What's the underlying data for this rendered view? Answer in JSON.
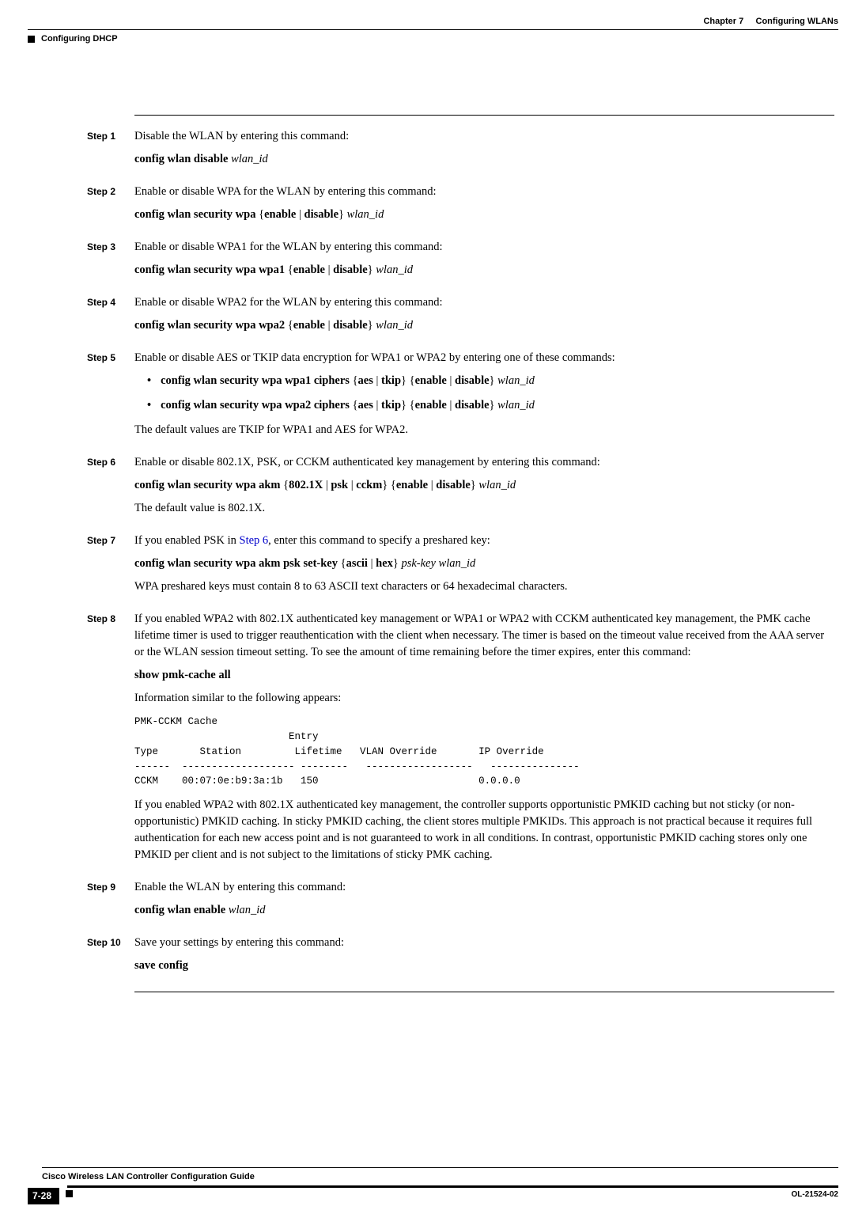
{
  "header": {
    "chapter_label": "Chapter 7",
    "chapter_title": "Configuring WLANs",
    "section_title": "Configuring DHCP"
  },
  "steps": [
    {
      "label": "Step 1",
      "lines": [
        {
          "type": "text",
          "value": "Disable the WLAN by entering this command:"
        },
        {
          "type": "cmd",
          "prefix": "config wlan disable ",
          "suffix_italic": "wlan_id"
        }
      ]
    },
    {
      "label": "Step 2",
      "lines": [
        {
          "type": "text",
          "value": "Enable or disable WPA for the WLAN by entering this command:"
        },
        {
          "type": "cmd",
          "prefix": "config wlan security wpa ",
          "mid1": "{",
          "mid2": "enable",
          "mid3": " | ",
          "mid4": "disable",
          "mid5": "} ",
          "suffix_italic": "wlan_id"
        }
      ]
    },
    {
      "label": "Step 3",
      "lines": [
        {
          "type": "text",
          "value": "Enable or disable WPA1 for the WLAN by entering this command:"
        },
        {
          "type": "cmd",
          "prefix": "config wlan security wpa wpa1 ",
          "mid1": "{",
          "mid2": "enable",
          "mid3": " | ",
          "mid4": "disable",
          "mid5": "} ",
          "suffix_italic": "wlan_id"
        }
      ]
    },
    {
      "label": "Step 4",
      "lines": [
        {
          "type": "text",
          "value": "Enable or disable WPA2 for the WLAN by entering this command:"
        },
        {
          "type": "cmd",
          "prefix": "config wlan security wpa wpa2 ",
          "mid1": "{",
          "mid2": "enable",
          "mid3": " | ",
          "mid4": "disable",
          "mid5": "} ",
          "suffix_italic": "wlan_id"
        }
      ]
    },
    {
      "label": "Step 5",
      "intro": "Enable or disable AES or TKIP data encryption for WPA1 or WPA2 by entering one of these commands:",
      "bullets": [
        {
          "prefix": "config wlan security wpa wpa1 ciphers ",
          "braces1": "{",
          "opt1": "aes",
          "sep1": " | ",
          "opt2": "tkip",
          "braces2": "} {",
          "opt3": "enable",
          "sep2": " | ",
          "opt4": "disable",
          "braces3": "} ",
          "suffix_italic": "wlan_id"
        },
        {
          "prefix": "config wlan security wpa wpa2 ciphers ",
          "braces1": "{",
          "opt1": "aes",
          "sep1": " | ",
          "opt2": "tkip",
          "braces2": "} {",
          "opt3": "enable",
          "sep2": " | ",
          "opt4": "disable",
          "braces3": "} ",
          "suffix_italic": "wlan_id"
        }
      ],
      "outro": "The default values are TKIP for WPA1 and AES for WPA2."
    },
    {
      "label": "Step 6",
      "lines": [
        {
          "type": "text",
          "value": "Enable or disable 802.1X, PSK, or CCKM authenticated key management by entering this command:"
        },
        {
          "type": "cmd_akm",
          "prefix": "config wlan security wpa akm ",
          "b1": "{",
          "o1": "802.1X",
          "s1": " | ",
          "o2": "psk",
          "s2": " | ",
          "o3": "cckm",
          "b2": "} {",
          "o4": "enable",
          "s3": " | ",
          "o5": "disable",
          "b3": "} ",
          "suffix_italic": "wlan_id"
        },
        {
          "type": "text",
          "value": "The default value is 802.1X."
        }
      ]
    },
    {
      "label": "Step 7",
      "step7_intro_pre": "If you enabled PSK in ",
      "step7_link": "Step 6",
      "step7_intro_post": ", enter this command to specify a preshared key:",
      "cmd_prefix": "config wlan security wpa akm psk set-key ",
      "cmd_b1": "{",
      "cmd_o1": "ascii",
      "cmd_s1": " | ",
      "cmd_o2": "hex",
      "cmd_b2": "} ",
      "cmd_suffix_italic": "psk-key wlan_id",
      "note": "WPA preshared keys must contain 8 to 63 ASCII text characters or 64 hexadecimal characters."
    },
    {
      "label": "Step 8",
      "intro": "If you enabled WPA2 with 802.1X authenticated key management or WPA1 or WPA2 with CCKM authenticated key management, the PMK cache lifetime timer is used to trigger reauthentication with the client when necessary. The timer is based on the timeout value received from the AAA server or the WLAN session timeout setting. To see the amount of time remaining before the timer expires, enter this command:",
      "cmd": "show pmk-cache all",
      "after_cmd": "Information similar to the following appears:",
      "code_output": "PMK-CCKM Cache\n                          Entry\nType       Station         Lifetime   VLAN Override       IP Override\n------  ------------------- --------   ------------------   ---------------\nCCKM    00:07:0e:b9:3a:1b   150                           0.0.0.0",
      "outro": "If you enabled WPA2 with 802.1X authenticated key management, the controller supports opportunistic PMKID caching but not sticky (or non-opportunistic) PMKID caching. In sticky PMKID caching, the client stores multiple PMKIDs. This approach is not practical because it requires full authentication for each new access point and is not guaranteed to work in all conditions. In contrast, opportunistic PMKID caching stores only one PMKID per client and is not subject to the limitations of sticky PMK caching."
    },
    {
      "label": "Step 9",
      "lines": [
        {
          "type": "text",
          "value": "Enable the WLAN by entering this command:"
        },
        {
          "type": "cmd",
          "prefix": "config wlan enable ",
          "suffix_italic": "wlan_id"
        }
      ]
    },
    {
      "label": "Step 10",
      "lines": [
        {
          "type": "text",
          "value": "Save your settings by entering this command:"
        },
        {
          "type": "cmd_simple",
          "value": "save config"
        }
      ]
    }
  ],
  "footer": {
    "book_title": "Cisco Wireless LAN Controller Configuration Guide",
    "page_number": "7-28",
    "doc_id": "OL-21524-02"
  }
}
